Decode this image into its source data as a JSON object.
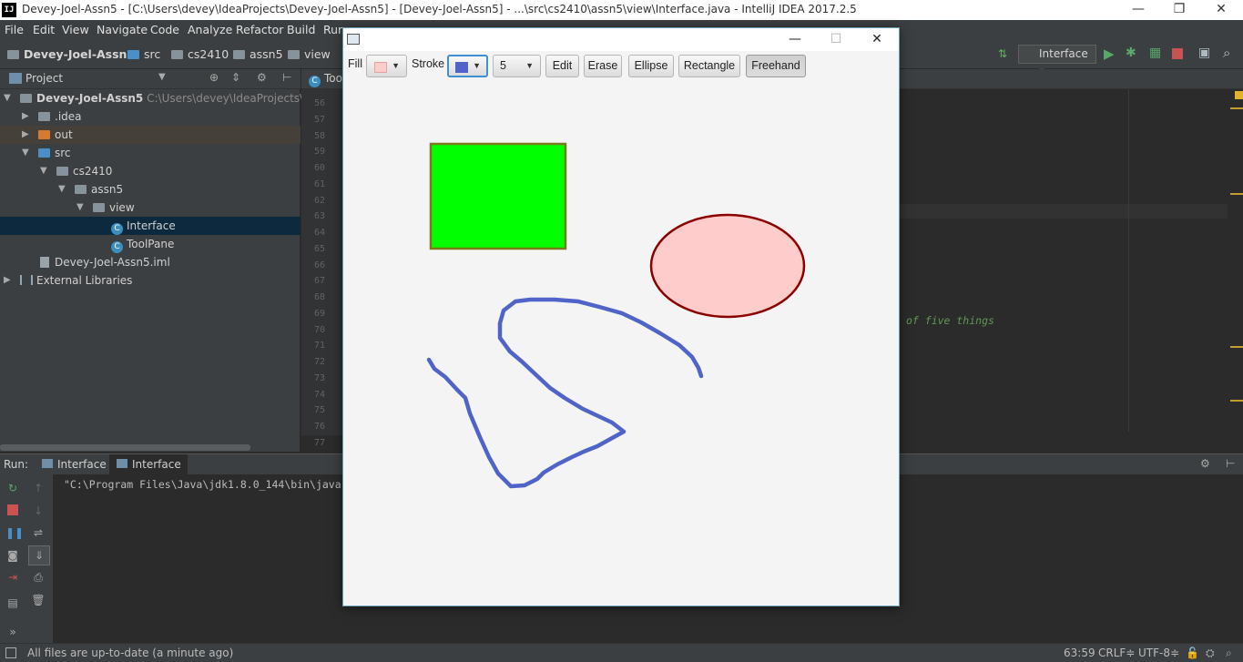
{
  "window": {
    "title": "Devey-Joel-Assn5 - [C:\\Users\\devey\\IdeaProjects\\Devey-Joel-Assn5] - [Devey-Joel-Assn5] - ...\\src\\cs2410\\assn5\\view\\Interface.java - IntelliJ IDEA 2017.2.5",
    "app_icon": "IJ",
    "minimize": "—",
    "restore": "❐",
    "close": "✕"
  },
  "menu": [
    "File",
    "Edit",
    "View",
    "Navigate",
    "Code",
    "Analyze",
    "Refactor",
    "Build",
    "Run"
  ],
  "nav": {
    "crumbs": [
      "Devey-Joel-Assn5",
      "src",
      "cs2410",
      "assn5",
      "view"
    ],
    "run_config": "Interface"
  },
  "project": {
    "header": "Project",
    "tree": [
      {
        "label": "Devey-Joel-Assn5",
        "path": "C:\\Users\\devey\\IdeaProjects\\Devey",
        "depth": 0,
        "icon": "folder-icon",
        "arrow": "▼"
      },
      {
        "label": ".idea",
        "depth": 1,
        "icon": "folder-icon",
        "arrow": "▶"
      },
      {
        "label": "out",
        "depth": 1,
        "icon": "folder-icon",
        "arrow": "▶"
      },
      {
        "label": "src",
        "depth": 1,
        "icon": "folder-icon",
        "arrow": "▼"
      },
      {
        "label": "cs2410",
        "depth": 2,
        "icon": "package-icon",
        "arrow": "▼"
      },
      {
        "label": "assn5",
        "depth": 3,
        "icon": "package-icon",
        "arrow": "▼"
      },
      {
        "label": "view",
        "depth": 4,
        "icon": "package-icon",
        "arrow": "▼"
      },
      {
        "label": "Interface",
        "depth": 5,
        "icon": "class-icon",
        "arrow": ""
      },
      {
        "label": "ToolPane",
        "depth": 5,
        "icon": "class-icon",
        "arrow": ""
      },
      {
        "label": "Devey-Joel-Assn5.iml",
        "depth": 2,
        "icon": "file-icon",
        "arrow": ""
      },
      {
        "label": "External Libraries",
        "depth": 0,
        "icon": "library-icon",
        "arrow": "▶"
      }
    ]
  },
  "editor": {
    "tab": "Too",
    "line_numbers": [
      "56",
      "57",
      "58",
      "59",
      "60",
      "61",
      "62",
      "63",
      "64",
      "65",
      "66",
      "67",
      "68",
      "69",
      "70",
      "71",
      "72",
      "73",
      "74",
      "75",
      "76",
      "77"
    ],
    "comment_fragment": "of five things"
  },
  "run_panel": {
    "label": "Run:",
    "tabs": [
      "Interface",
      "Interface"
    ],
    "console": "\"C:\\Program Files\\Java\\jdk1.8.0_144\\bin\\java"
  },
  "status": {
    "message": "All files are up-to-date (a minute ago)",
    "position": "63:59",
    "line_sep": "CRLF≑",
    "encoding": "UTF-8≑"
  },
  "fx_app": {
    "fill_label": "Fill",
    "stroke_label": "Stroke",
    "fill_color": "#ffcccc",
    "stroke_color": "#4f63c9",
    "stroke_width": "5",
    "buttons": [
      "Edit",
      "Erase",
      "Ellipse",
      "Rectangle",
      "Freehand"
    ],
    "selected_tool": "Freehand",
    "minimize": "—",
    "maximize": "☐",
    "close": "✕"
  },
  "colors": {
    "rect_fill": "#00ff00",
    "rect_stroke": "#7a7a1a",
    "ellipse_fill": "#ffcccc",
    "ellipse_stroke": "#8b0000",
    "freehand_stroke": "#4f63c9"
  }
}
